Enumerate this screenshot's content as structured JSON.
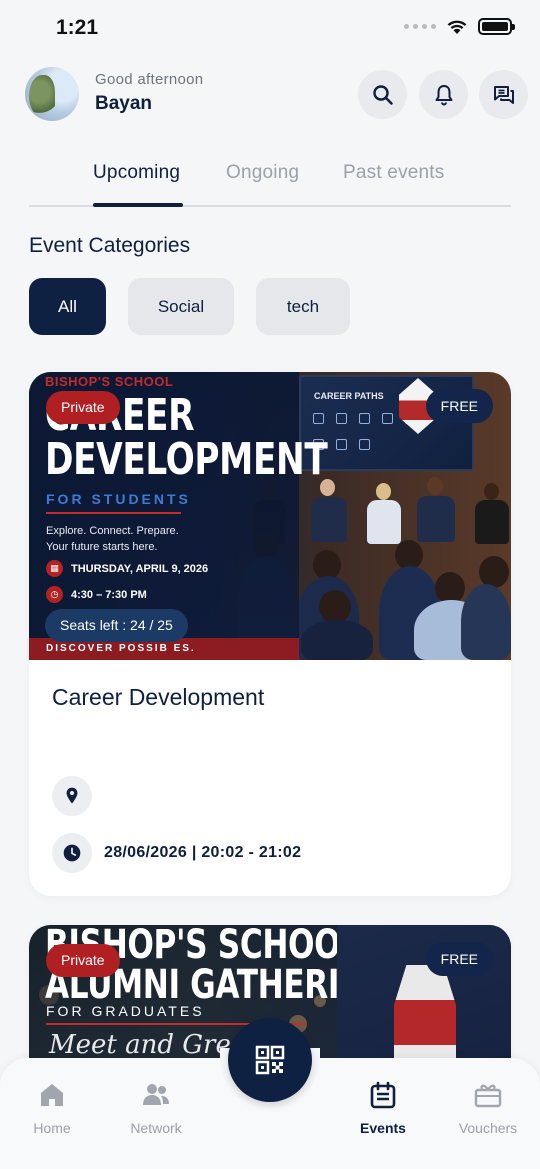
{
  "status_bar": {
    "time": "1:21"
  },
  "header": {
    "greeting": "Good afternoon",
    "username": "Bayan",
    "icons": [
      "search-icon",
      "bell-icon",
      "chat-icon"
    ]
  },
  "tabs": [
    {
      "label": "Upcoming",
      "active": true
    },
    {
      "label": "Ongoing",
      "active": false
    },
    {
      "label": "Past events",
      "active": false
    }
  ],
  "categories": {
    "title": "Event Categories",
    "items": [
      {
        "label": "All",
        "active": true
      },
      {
        "label": "Social",
        "active": false
      },
      {
        "label": "tech",
        "active": false
      }
    ]
  },
  "events": [
    {
      "title": "Career Development",
      "privacy_badge": "Private",
      "price_badge": "FREE",
      "seats": "Seats left : 24 / 25",
      "location": "",
      "datetime": "28/06/2026 | 20:02 - 21:02",
      "poster": {
        "school": "BISHOP'S SCHOOL",
        "title_line1": "CAREER",
        "title_line2": "DEVELOPMENT",
        "subtitle": "FOR STUDENTS",
        "tagline_line1": "Explore. Connect. Prepare.",
        "tagline_line2": "Your future starts here.",
        "date": "THURSDAY, APRIL 9, 2026",
        "time": "4:30 – 7:30 PM",
        "footer": "DISCOVER POSSIB    ES.",
        "screen_title": "CAREER PATHS"
      }
    },
    {
      "privacy_badge": "Private",
      "price_badge": "FREE",
      "poster": {
        "title_line1": "BISHOP'S SCHOOL",
        "title_line2": "ALUMNI GATHERING",
        "subtitle": "FOR GRADUATES",
        "script": "Meet and Greet"
      }
    }
  ],
  "bottom_nav": [
    {
      "label": "Home",
      "icon": "home-icon",
      "active": false
    },
    {
      "label": "Network",
      "icon": "people-icon",
      "active": false
    },
    {
      "label": "Events",
      "icon": "events-icon",
      "active": true
    },
    {
      "label": "Vouchers",
      "icon": "voucher-icon",
      "active": false
    }
  ],
  "colors": {
    "primary": "#0f2142",
    "private": "#b01f22",
    "inactive_text": "#9aa1ab",
    "background": "#f5f6f8"
  }
}
